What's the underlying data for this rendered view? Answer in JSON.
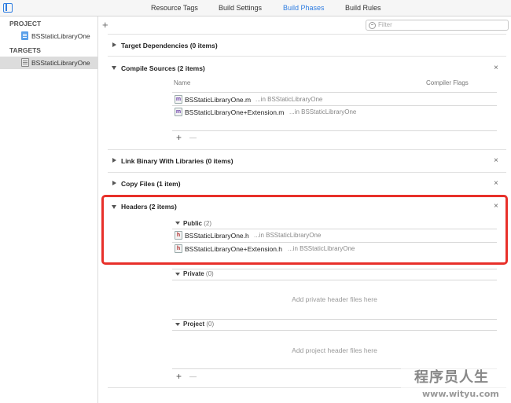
{
  "tabs": [
    "Resource Tags",
    "Build Settings",
    "Build Phases",
    "Build Rules"
  ],
  "active_tab": "Build Phases",
  "sidebar": {
    "project_header": "PROJECT",
    "project_item": "BSStaticLibraryOne",
    "targets_header": "TARGETS",
    "target_item": "BSStaticLibraryOne"
  },
  "toolbar": {
    "add_symbol": "+",
    "filter_placeholder": "Filter"
  },
  "phases": {
    "target_dependencies": {
      "title": "Target Dependencies (0 items)"
    },
    "compile_sources": {
      "title": "Compile Sources (2 items)",
      "col_name": "Name",
      "col_flags": "Compiler Flags",
      "files": [
        {
          "badge": "m",
          "name": "BSStaticLibraryOne.m",
          "location": "...in BSStaticLibraryOne"
        },
        {
          "badge": "m",
          "name": "BSStaticLibraryOne+Extension.m",
          "location": "...in BSStaticLibraryOne"
        }
      ],
      "add": "+",
      "remove": "—"
    },
    "link_binary": {
      "title": "Link Binary With Libraries (0 items)"
    },
    "copy_files": {
      "title": "Copy Files (1 item)"
    },
    "headers": {
      "title": "Headers (2 items)",
      "public": {
        "label": "Public",
        "count": "(2)",
        "files": [
          {
            "badge": "h",
            "name": "BSStaticLibraryOne.h",
            "location": "...in BSStaticLibraryOne"
          },
          {
            "badge": "h",
            "name": "BSStaticLibraryOne+Extension.h",
            "location": "...in BSStaticLibraryOne"
          }
        ]
      },
      "private": {
        "label": "Private",
        "count": "(0)",
        "empty": "Add private header files here"
      },
      "project": {
        "label": "Project",
        "count": "(0)",
        "empty": "Add project header files here"
      },
      "add": "+",
      "remove": "—"
    }
  },
  "close_symbol": "×",
  "watermark": {
    "text": "程序员人生",
    "url": "www.wityu.com"
  },
  "colors": {
    "accent": "#2f7de1",
    "highlight": "#e8302a"
  }
}
